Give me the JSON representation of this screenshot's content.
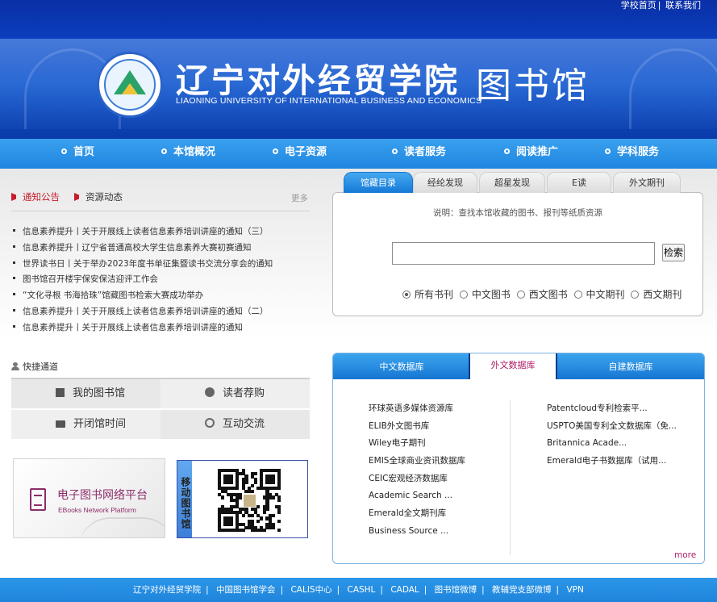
{
  "header": {
    "top_links": [
      "学校首页",
      "联系我们"
    ],
    "school_name": "辽宁对外经贸学院",
    "school_name_en": "LIAONING UNIVERSITY OF INTERNATIONAL BUSINESS AND ECONOMICS",
    "library_name": "图书馆"
  },
  "nav": {
    "items": [
      "首页",
      "本馆概况",
      "电子资源",
      "读者服务",
      "阅读推广",
      "学科服务"
    ]
  },
  "notice": {
    "tabs": [
      "通知公告",
      "资源动态"
    ],
    "more": "更多",
    "items": [
      "信息素养提升丨关于开展线上读者信息素养培训讲座的通知（三）",
      "信息素养提升丨辽宁省普通高校大学生信息素养大赛初赛通知",
      "世界读书日丨关于举办2023年度书单征集暨读书交流分享会的通知",
      "图书馆召开楼宇保安保洁迎评工作会",
      "“文化寻根 书海拾珠”馆藏图书检索大赛成功举办",
      "信息素养提升丨关于开展线上读者信息素养培训讲座的通知（二）",
      "信息素养提升丨关于开展线上读者信息素养培训讲座的通知"
    ]
  },
  "search": {
    "tabs": [
      "馆藏目录",
      "经纶发现",
      "超星发现",
      "E读",
      "外文期刊"
    ],
    "hint": "说明：查找本馆收藏的图书、报刊等纸质资源",
    "input_value": "",
    "button": "检索",
    "radios": [
      "所有书刊",
      "中文图书",
      "西文图书",
      "中文期刊",
      "西文期刊"
    ],
    "selected": "所有书刊"
  },
  "quick": {
    "title": "快捷通道",
    "items": [
      "我的图书馆",
      "读者荐购",
      "开闭馆时间",
      "互动交流"
    ]
  },
  "banners": {
    "ebook_title": "电子图书网络平台",
    "ebook_sub": "EBooks Network Platform",
    "mobile_label": "移动图书馆"
  },
  "databases": {
    "tabs": [
      "中文数据库",
      "外文数据库",
      "自建数据库"
    ],
    "active_tab": "外文数据库",
    "col1": [
      "环球英语多媒体资源库",
      "ELIB外文图书库",
      "Wiley电子期刊",
      "EMIS全球商业资讯数据库",
      "CEIC宏观经济数据库",
      "Academic Search ...",
      "Emerald全文期刊库",
      "Business Source ..."
    ],
    "col2": [
      "Patentcloud专利检索平...",
      "USPTO美国专利全文数据库（免...",
      "Britannica Acade...",
      "Emerald电子书数据库（试用..."
    ],
    "more": "more"
  },
  "footer": {
    "links": [
      "辽宁对外经贸学院",
      "中国图书馆学会",
      "CALIS中心",
      "CASHL",
      "CADAL",
      "图书馆微博",
      "教辅党支部微博",
      "VPN"
    ]
  },
  "colors": {
    "header_blue": "#0b3fbf",
    "nav_blue": "#1e86e0",
    "notice_red": "#c81c2c",
    "db_active": "#b0206a",
    "ebook_purple": "#8c2d6a"
  }
}
